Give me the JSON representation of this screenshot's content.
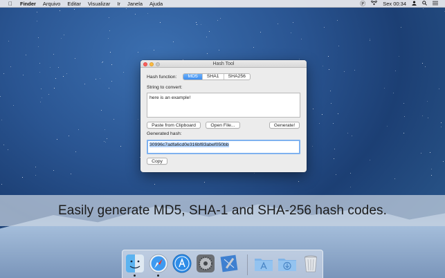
{
  "menubar": {
    "apple_icon": "apple-icon",
    "app_name": "Finder",
    "items": [
      "Arquivo",
      "Editar",
      "Visualizar",
      "Ir",
      "Janela",
      "Ajuda"
    ],
    "clock": "Sex 00:34"
  },
  "window": {
    "title": "Hash Tool",
    "hash_function_label": "Hash function:",
    "hash_options": [
      "MD5",
      "SHA1",
      "SHA256"
    ],
    "selected_hash": "MD5",
    "string_label": "String to convert:",
    "input_value": "here is an example!",
    "paste_button": "Paste from Clipboard",
    "open_file_button": "Open File...",
    "generate_button": "Generate!",
    "generated_label": "Generated hash:",
    "hash_value": "30996c7adfa6cd0e316bf83abef050bb",
    "copy_button": "Copy"
  },
  "banner_text": "Easily generate MD5, SHA-1 and SHA-256 hash codes.",
  "dock": {
    "apps": [
      "Finder",
      "Safari",
      "App Store",
      "System Preferences",
      "Xcode"
    ],
    "folders": [
      "Applications",
      "Downloads",
      "Trash"
    ]
  },
  "colors": {
    "accent": "#3d8ef0",
    "selection": "#b5d4fb",
    "close": "#fc605c",
    "minimize": "#fdbc40"
  }
}
